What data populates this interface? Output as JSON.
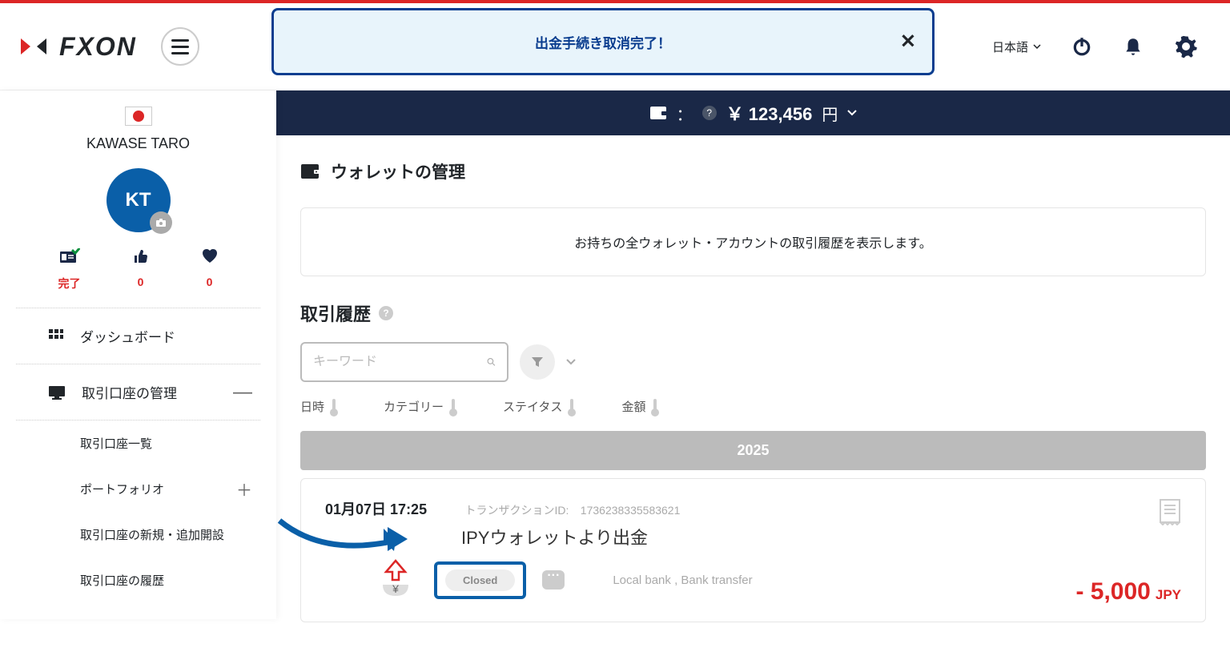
{
  "toast": {
    "message": "出金手続き取消完了！"
  },
  "header": {
    "language": "日本語"
  },
  "balance": {
    "amount": "￥ 123,456",
    "currency": "円"
  },
  "sidebar": {
    "username": "KAWASE TARO",
    "avatar_initials": "KT",
    "stats": {
      "complete_label": "完了",
      "thumbs_count": "0",
      "hearts_count": "0"
    },
    "menu": {
      "dashboard": "ダッシュボード",
      "account_mgmt": "取引口座の管理",
      "items": {
        "list": "取引口座一覧",
        "portfolio": "ポートフォリオ",
        "new": "取引口座の新規・追加開設",
        "history": "取引口座の履歴"
      }
    }
  },
  "page": {
    "title": "ウォレットの管理",
    "description": "お持ちの全ウォレット・アカウントの取引履歴を表示します。",
    "history_title": "取引履歴",
    "search_placeholder": "キーワード",
    "sorters": {
      "date": "日時",
      "category": "カテゴリー",
      "status": "ステイタス",
      "amount": "金額"
    },
    "year": "2025"
  },
  "transaction": {
    "date": "01月07日 17:25",
    "id_label": "トランザクションID:",
    "id": "1736238335583621",
    "title": "IPYウォレットより出金",
    "status": "Closed",
    "method": "Local bank , Bank transfer",
    "amount": "- 5,000",
    "currency": "JPY"
  }
}
